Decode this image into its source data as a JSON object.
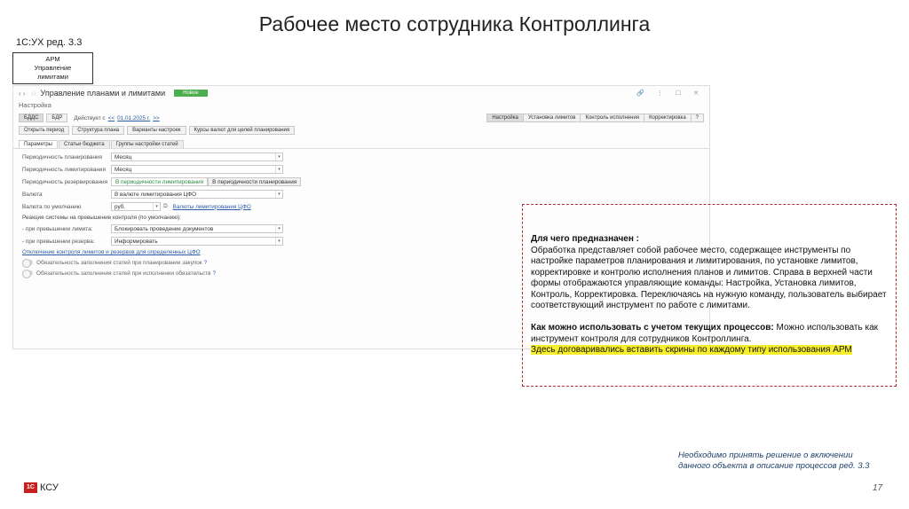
{
  "slide": {
    "title": "Рабочее место сотрудника Контроллинга",
    "subtitle": "1С:УХ ред. 3.3",
    "arm_box": [
      "АРМ",
      "Управление",
      "лимитами"
    ],
    "page_number": "17",
    "logo_mark": "1С",
    "logo_text": "КСУ",
    "decision_note": [
      "Необходимо принять решение о включении",
      "данного объекта в описание процессов ред. 3.3"
    ]
  },
  "app": {
    "window_title": "Управление планами и лимитами",
    "new_button": "Новое",
    "header_icons": "🔗 ⋮ ☐ ✕",
    "breadcrumb": "Настройка",
    "toolbar1": {
      "bdds": "БДДС",
      "bdr": "БДР",
      "acts_from_label": "Действует с",
      "date": "01.01.2025 г.",
      "right_buttons": [
        "Настройка",
        "Установка лимитов",
        "Контроль исполнения",
        "Корректировка",
        "?"
      ]
    },
    "toolbar2": [
      "Открыть период",
      "Структура плана",
      "Варианты настроек",
      "Курсы валют для целей планирования"
    ],
    "tabs": [
      "Параметры",
      "Статьи бюджета",
      "Группы настройки статей"
    ],
    "form": {
      "planning_period_label": "Периодичность планирования",
      "planning_period_value": "Месяц",
      "limit_period_label": "Периодичность лимитирования",
      "limit_period_value": "Месяц",
      "reserve_period_label": "Периодичность резервирования",
      "reserve_options": [
        "В периодичности лимитирования",
        "В периодичности планирования"
      ],
      "currency_label": "Валюта",
      "currency_value": "В валюте лимитирования ЦФО",
      "default_currency_label": "Валюта по умолчанию",
      "default_currency_value": "руб.",
      "default_currency_link": "Валюты лимитирования ЦФО",
      "reaction_header": "Реакция системы на превышение контроля (по умолчанию):",
      "limit_exceed_label": "- при превышении лимита:",
      "limit_exceed_value": "Блокировать проведение документов",
      "reserve_exceed_label": "- при превышении резерва:",
      "reserve_exceed_value": "Информировать",
      "disable_link": "Отключение контроля лимитов и резервов для определенных ЦФО",
      "toggle1": "Обязательность заполнения статей при планировании закупок",
      "toggle2": "Обязательность заполнения статей при исполнении обязательств"
    }
  },
  "note": {
    "heading1": "Для чего предназначен :",
    "text1": "Обработка представляет собой рабочее место, содержащее инструменты по настройке параметров планирования и лимитирования, по установке лимитов, корректировке и контролю исполнения планов и лимитов. Справа в верхней части формы отображаются управляющие команды: Настройка, Установка лимитов, Контроль, Корректировка. Переключаясь на нужную команду, пользователь выбирает соответствующий инструмент по работе с лимитами.",
    "heading2": "Как можно использовать с учетом текущих процессов:",
    "text2": "Можно использовать как инструмент контроля для сотрудников Контроллинга.",
    "highlight": "Здесь договаривались вставить скрины  по каждому типу использования АРМ",
    "highlight_color": "#f6ee2a"
  }
}
